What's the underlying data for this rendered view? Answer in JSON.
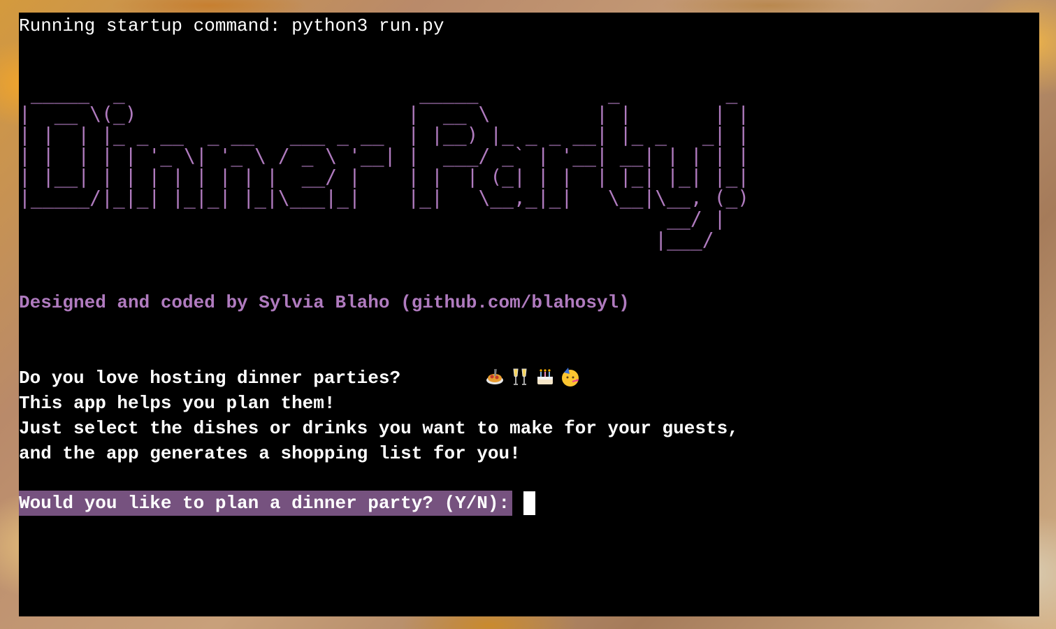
{
  "terminal": {
    "startup_line": "Running startup command: python3 run.py",
    "banner_ascii": " _____  _                         _____           _         _ \n|  __ \\(_)                       |  __ \\         | |       | |\n| |  | |_ _ __  _ __   ___ _ __  | |__) |_ _ _ __| |_ _   _| |\n| |  | | | '_ \\| '_ \\ / _ \\ '__| |  ___/ _` | '__| __| | | | |\n| |__| | | | | | | | |  __/ |    | |  | (_| | |  | |_| |_| |_|\n|_____/|_|_| |_|_| |_|\\___|_|    |_|   \\__,_|_|   \\__|\\__, (_)\n                                                       __/ |  \n                                                      |___/   ",
    "credits": "Designed and coded by Sylvia Blaho (github.com/blahosyl)",
    "intro_lines": [
      "Do you love hosting dinner parties?",
      "This app helps you plan them!",
      "Just select the dishes or drinks you want to make for your guests,",
      "and the app generates a shopping list for you!"
    ],
    "intro_emojis": [
      "spaghetti-icon",
      "champagne-glasses-icon",
      "birthday-cake-icon",
      "partying-face-icon"
    ],
    "prompt": "Would you like to plan a dinner party? (Y/N):",
    "colors": {
      "background": "#000000",
      "text": "#ffffff",
      "accent_purple": "#b07bbf",
      "prompt_highlight": "#76527f"
    }
  }
}
